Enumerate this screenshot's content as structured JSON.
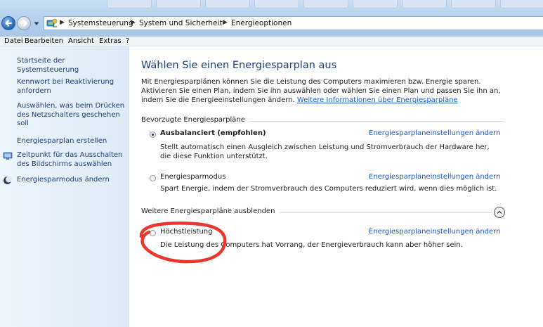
{
  "addressbar": {
    "breadcrumbs": [
      "Systemsteuerung",
      "System und Sicherheit",
      "Energieoptionen"
    ]
  },
  "menubar": {
    "items": [
      "Datei",
      "Bearbeiten",
      "Ansicht",
      "Extras",
      "?"
    ]
  },
  "sidebar": {
    "items": [
      {
        "label": "Startseite der Systemsteuerung",
        "icon": ""
      },
      {
        "label": "Kennwort bei Reaktivierung anfordern",
        "icon": ""
      },
      {
        "label": "Auswählen, was beim Drücken des Netzschalters geschehen soll",
        "icon": ""
      },
      {
        "label": "Energiesparplan erstellen",
        "icon": ""
      },
      {
        "label": "Zeitpunkt für das Ausschalten des Bildschirms auswählen",
        "icon": "monitor-icon"
      },
      {
        "label": "Energiesparmodus ändern",
        "icon": "moon-icon"
      }
    ]
  },
  "main": {
    "title": "Wählen Sie einen Energiesparplan aus",
    "intro": "Mit Energiesparplänen können Sie die Leistung des Computers maximieren bzw. Energie sparen. Aktivieren Sie einen Plan, indem Sie ihn auswählen oder wählen Sie einen Plan und passen Sie ihn an, indem Sie die Energieeinstellungen ändern.",
    "intro_link": "Weitere Informationen über Energiesparpläne",
    "preferred_header": "Bevorzugte Energiesparpläne",
    "more_header": "Weitere Energiesparpläne ausblenden",
    "plans": [
      {
        "name": "Ausbalanciert (empfohlen)",
        "selected": true,
        "description": "Stellt automatisch einen Ausgleich zwischen Leistung und Stromverbrauch der Hardware her, die diese Funktion unterstützt.",
        "link": "Energiesparplaneinstellungen ändern"
      },
      {
        "name": "Energiesparmodus",
        "selected": false,
        "description": "Spart Energie, indem der Stromverbrauch des Computers reduziert wird, wenn dies möglich ist.",
        "link": "Energiesparplaneinstellungen ändern"
      },
      {
        "name": "Höchstleistung",
        "selected": false,
        "description": "Die Leistung des Computers hat Vorrang, der Energieverbrauch kann aber höher sein.",
        "link": "Energiesparplaneinstellungen ändern"
      }
    ]
  },
  "colors": {
    "link": "#1e58c3",
    "title": "#1a3f7e",
    "annotation": "#e8372c"
  }
}
